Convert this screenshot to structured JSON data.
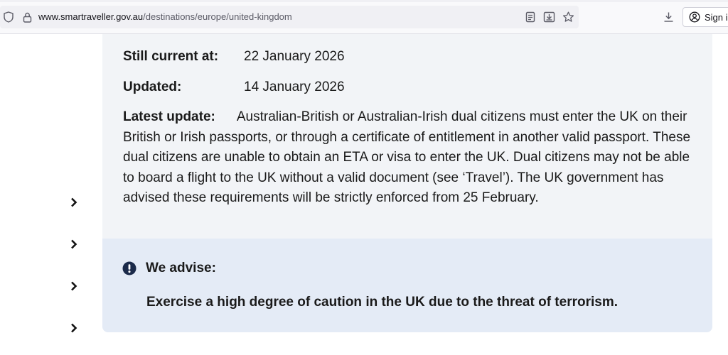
{
  "browser": {
    "url_host": "www.smartraveller.gov.au",
    "url_path": "/destinations/europe/united-kingdom",
    "signin_label": "Sign in",
    "icons": [
      "shield-icon",
      "lock-icon",
      "reader-view-icon",
      "save-page-icon",
      "bookmark-star-icon",
      "downloads-icon",
      "account-icon"
    ]
  },
  "advice": {
    "still_current_label": "Still current at:",
    "still_current_value": "22 January 2026",
    "updated_label": "Updated:",
    "updated_value": "14 January 2026",
    "latest_update_label": "Latest update:",
    "latest_update_text": "Australian-British or Australian-Irish dual citizens must enter the UK on their British or Irish passports, or through a certificate of entitlement in another valid passport. These dual citizens are unable to obtain an ETA or visa to enter the UK. Dual citizens may not be able to board a flight to the UK without a valid document (see ‘Travel’). The UK government has advised these requirements will be strictly enforced from 25 February."
  },
  "we_advise": {
    "title": "We advise:",
    "message": "Exercise a high degree of caution in the UK due to the threat of terrorism."
  },
  "colors": {
    "card_bg": "#f2f4f7",
    "advise_bg": "#e4ebf6",
    "alert_icon": "#1b2a4a"
  }
}
